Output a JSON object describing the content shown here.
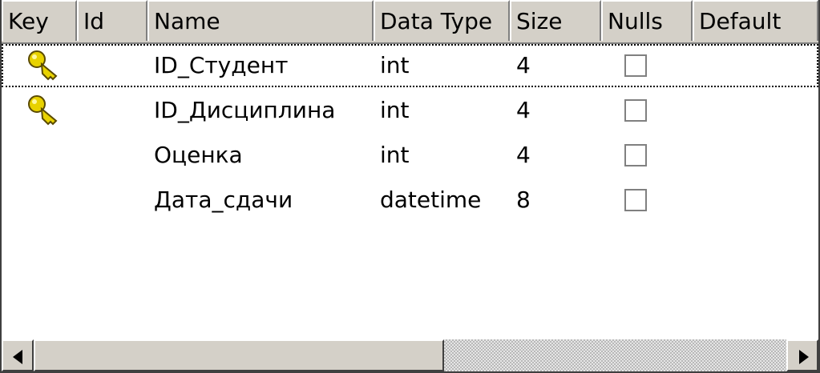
{
  "columns": [
    {
      "label": "Key"
    },
    {
      "label": "Id"
    },
    {
      "label": "Name"
    },
    {
      "label": "Data Type"
    },
    {
      "label": "Size"
    },
    {
      "label": "Nulls"
    },
    {
      "label": "Default"
    }
  ],
  "rows": [
    {
      "key": true,
      "name": "ID_Студент",
      "type": "int",
      "size": "4",
      "nulls": false,
      "selected": true
    },
    {
      "key": true,
      "name": "ID_Дисциплина",
      "type": "int",
      "size": "4",
      "nulls": false,
      "selected": false
    },
    {
      "key": false,
      "name": "Оценка",
      "type": "int",
      "size": "4",
      "nulls": false,
      "selected": false
    },
    {
      "key": false,
      "name": "Дата_сдачи",
      "type": "datetime",
      "size": "8",
      "nulls": false,
      "selected": false
    }
  ],
  "colors": {
    "header_bg": "#d4d0c8",
    "key_gold": "#e8d200"
  },
  "icons": {
    "key": "primary-key-icon",
    "scroll_left": "arrow-left-icon",
    "scroll_right": "arrow-right-icon"
  }
}
